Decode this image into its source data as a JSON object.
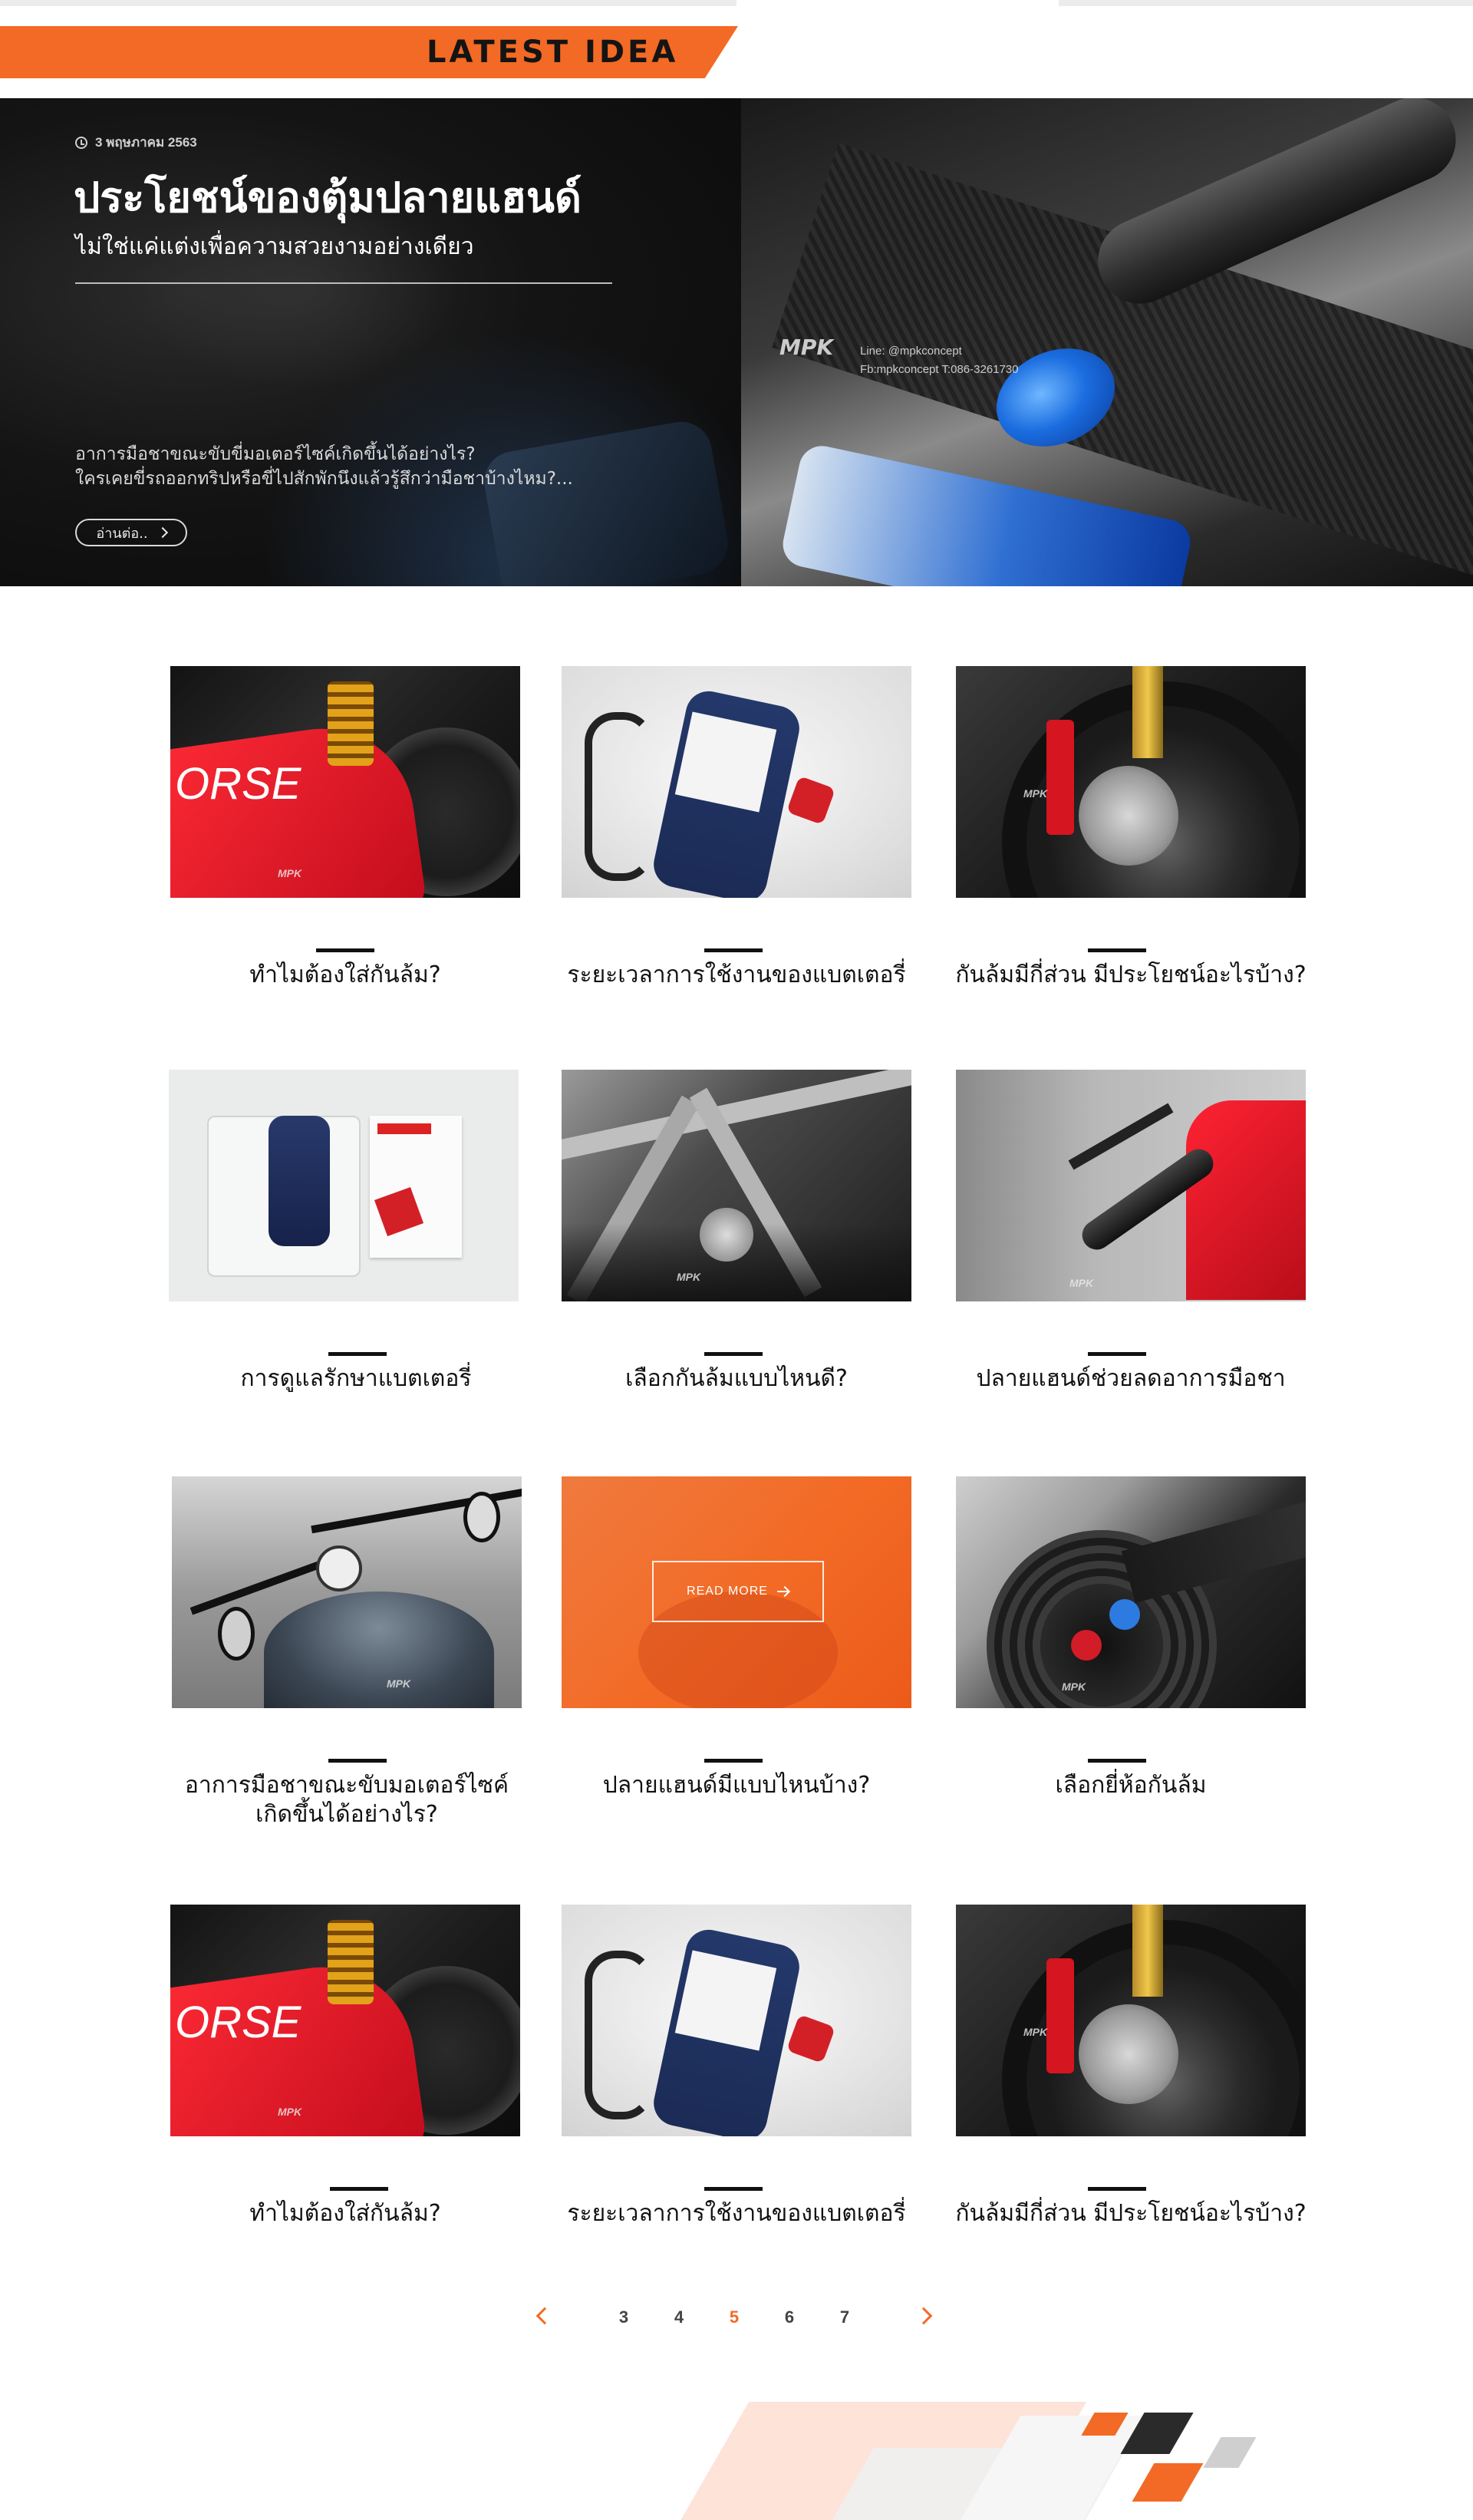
{
  "section": {
    "title": "LATEST IDEA"
  },
  "hero": {
    "date": "3 พฤษภาคม 2563",
    "title": "ประโยชน์ของตุ้มปลายแฮนด์",
    "subtitle": "ไม่ใช่แค่แต่งเพื่อความสวยงามอย่างเดียว",
    "excerpt_line1": "อาการมือชาขณะขับขี่มอเตอร์ไซค์เกิดขึ้นได้อย่างไร?",
    "excerpt_line2": "ใครเคยขี่รถออกทริปหรือขี่ไปสักพักนึงแล้วรู้สึกว่ามือชาบ้างไหม?...",
    "readmore_label": "อ่านต่อ..",
    "image_logo": "MPK",
    "image_watermark_line1": "Line: @mpkconcept",
    "image_watermark_line2": "Fb:mpkconcept T:086-3261730"
  },
  "cards": [
    {
      "title": "ทำไมต้องใส่กันล้ม?",
      "image_text": "ORSE"
    },
    {
      "title": "ระยะเวลาการใช้งานของแบตเตอรี่"
    },
    {
      "title": "กันล้มมีกี่ส่วน มีประโยชน์อะไรบ้าง?"
    },
    {
      "title": "การดูแลรักษาแบตเตอรี่"
    },
    {
      "title": "เลือกกันล้มแบบไหนดี?"
    },
    {
      "title": "ปลายแฮนด์ช่วยลดอาการมือชา"
    },
    {
      "title_line1": "อาการมือชาขณะขับมอเตอร์ไซค์",
      "title_line2": "เกิดขึ้นได้อย่างไร?"
    },
    {
      "title": "ปลายแฮนด์มีแบบไหนบ้าง?",
      "overlay_label": "READ MORE"
    },
    {
      "title": "เลือกยี่ห้อกันล้ม"
    },
    {
      "title": "ทำไมต้องใส่กันล้ม?",
      "image_text": "ORSE"
    },
    {
      "title": "ระยะเวลาการใช้งานของแบตเตอรี่"
    },
    {
      "title": "กันล้มมีกี่ส่วน มีประโยชน์อะไรบ้าง?"
    }
  ],
  "watermark": "MPK",
  "pagination": {
    "pages": [
      "3",
      "4",
      "5",
      "6",
      "7"
    ],
    "current": "5"
  },
  "colors": {
    "accent": "#f26a25",
    "text": "#111111"
  },
  "icons": {
    "date": "clock-icon",
    "readmore": "chevron-right-icon",
    "prev": "chevron-left-icon",
    "next": "chevron-right-icon",
    "overlay": "arrow-right-icon"
  }
}
